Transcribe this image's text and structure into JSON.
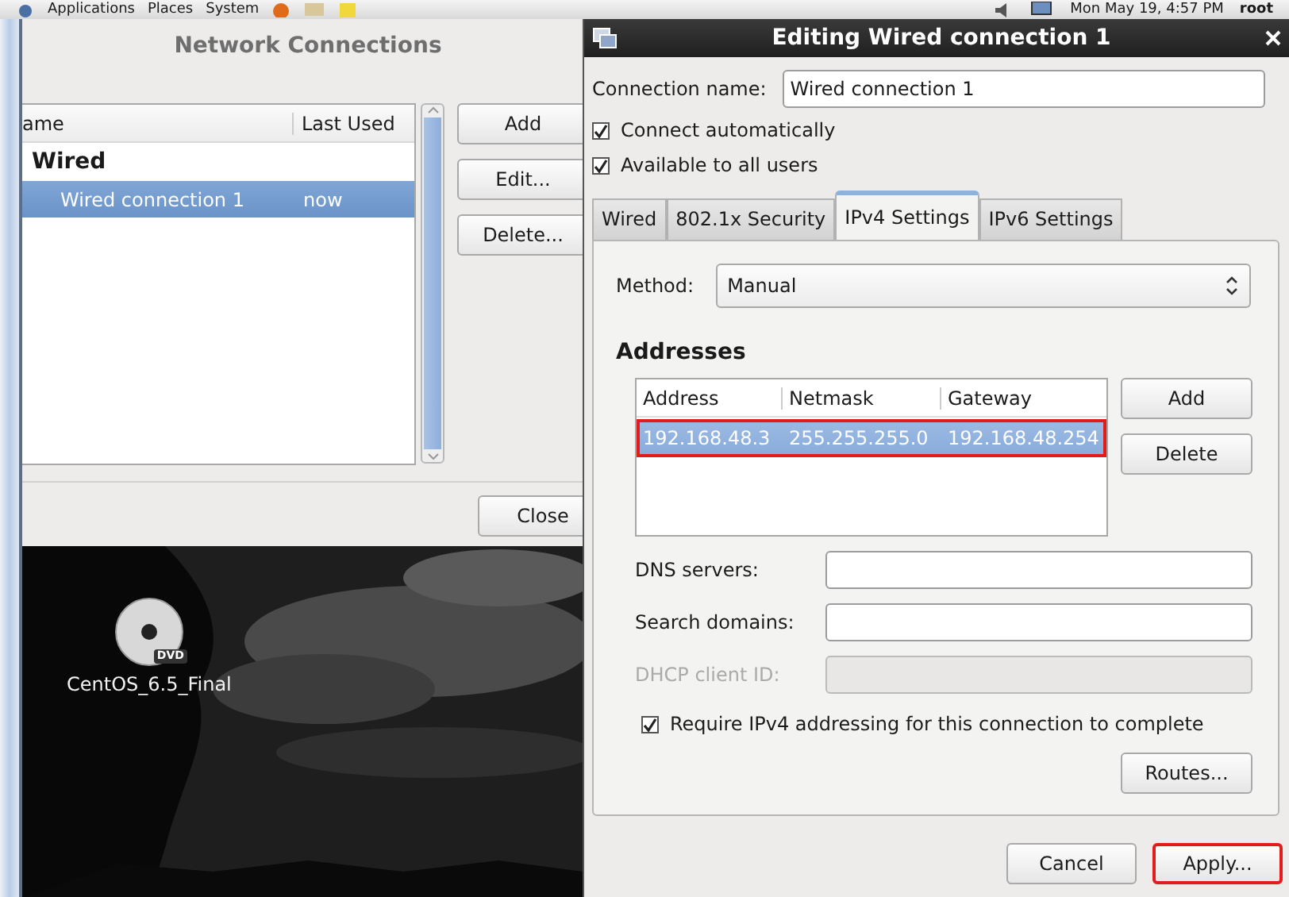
{
  "top_panel": {
    "menus": [
      "Applications",
      "Places",
      "System"
    ],
    "clock": "Mon May 19,  4:57 PM",
    "user": "root"
  },
  "network_connections": {
    "title": "Network Connections",
    "columns": [
      "ame",
      "Last Used"
    ],
    "groups": [
      {
        "label": "Wired",
        "rows": [
          {
            "name": "Wired connection 1",
            "last_used": "now",
            "selected": true
          }
        ]
      }
    ],
    "buttons": [
      "Add",
      "Edit...",
      "Delete..."
    ],
    "close": "Close"
  },
  "desktop_icons": [
    {
      "label": "CentOS_6.5_Final",
      "badge": "DVD"
    }
  ],
  "editor": {
    "title": "Editing Wired connection 1",
    "connection_name": {
      "label": "Connection name:",
      "value": "Wired connection 1"
    },
    "options": [
      {
        "label": "Connect automatically",
        "checked": true
      },
      {
        "label": "Available to all users",
        "checked": true
      }
    ],
    "tabs": [
      {
        "label": "Wired",
        "selected": false
      },
      {
        "label": "802.1x Security",
        "selected": false
      },
      {
        "label": "IPv4 Settings",
        "selected": true
      },
      {
        "label": "IPv6 Settings",
        "selected": false
      }
    ],
    "method": {
      "label": "Method:",
      "value": "Manual"
    },
    "addresses": {
      "heading": "Addresses",
      "columns": [
        "Address",
        "Netmask",
        "Gateway"
      ],
      "rows": [
        {
          "cells": [
            "192.168.48.3",
            "255.255.255.0",
            "192.168.48.254"
          ],
          "selected": true,
          "highlighted": true
        }
      ],
      "buttons": [
        "Add",
        "Delete"
      ]
    },
    "fields": [
      {
        "label": "DNS servers:",
        "disabled": false
      },
      {
        "label": "Search domains:",
        "disabled": false
      },
      {
        "label": "DHCP client ID:",
        "disabled": true
      }
    ],
    "require": {
      "label": "Require IPv4 addressing for this connection to complete",
      "checked": true
    },
    "routes": "Routes...",
    "buttons": [
      {
        "label": "Cancel",
        "highlighted": false
      },
      {
        "label": "Apply...",
        "highlighted": true
      }
    ]
  }
}
